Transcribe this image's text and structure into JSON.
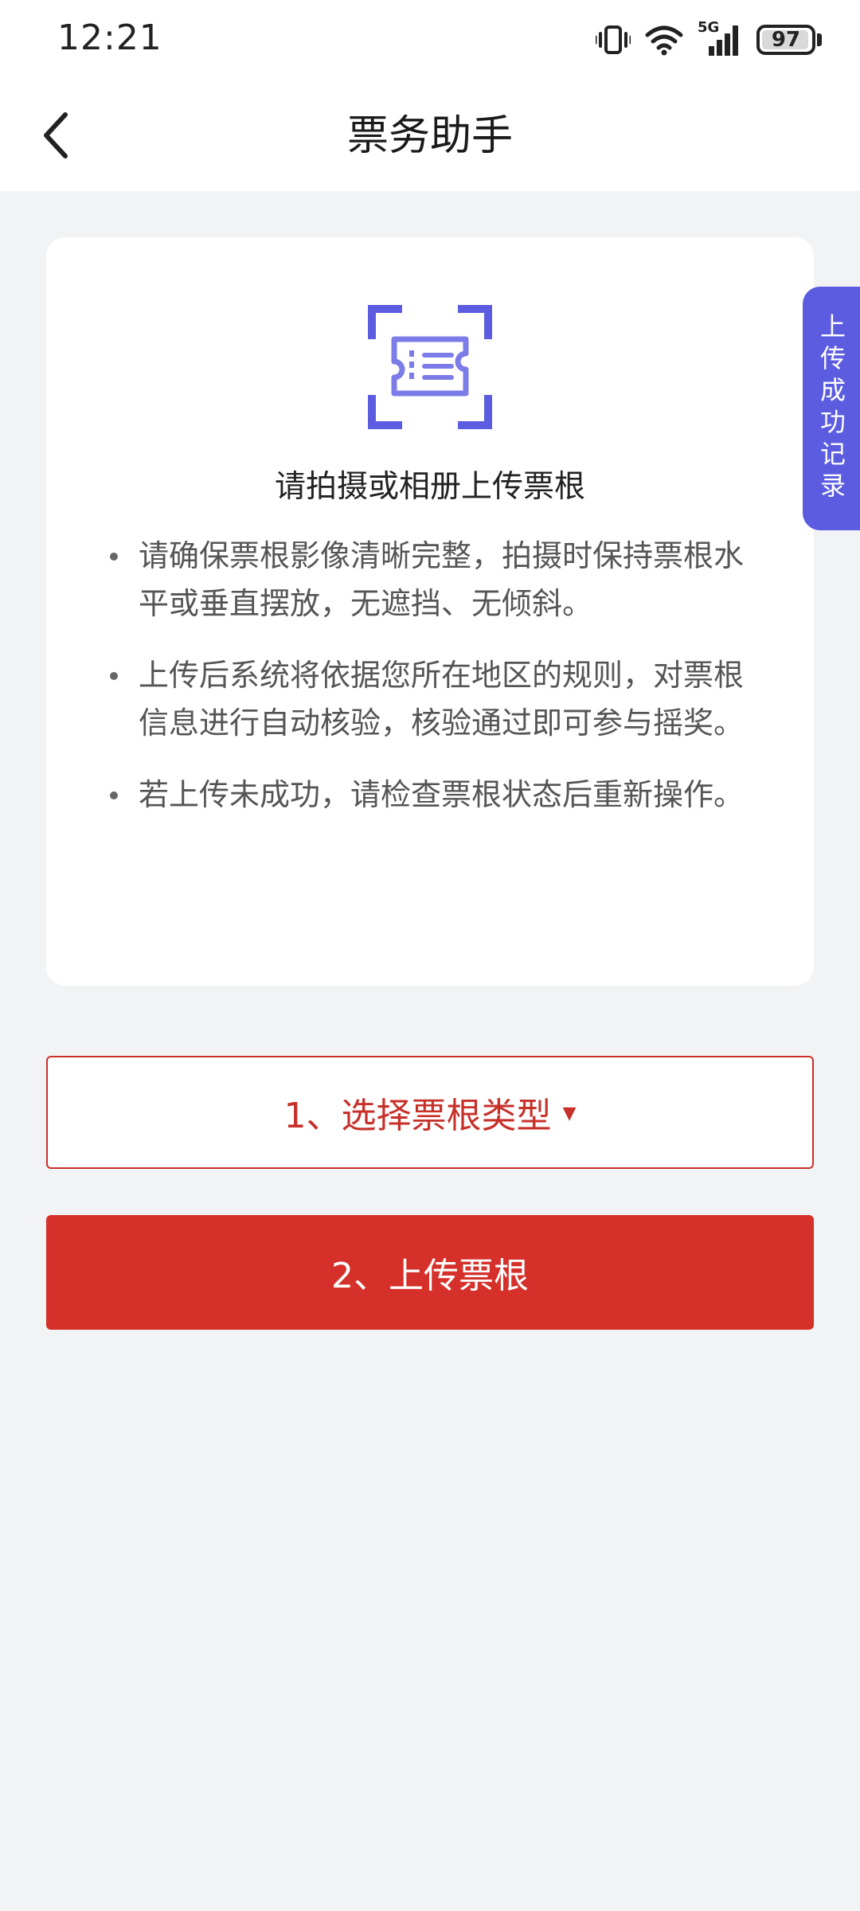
{
  "status_bar": {
    "time": "12:21",
    "network": "5G",
    "battery": "97",
    "battery_level": 0.97,
    "icons": [
      "vibrate-icon",
      "wifi-icon",
      "signal-icon",
      "battery-icon"
    ]
  },
  "header": {
    "title": "票务助手",
    "back_icon": "chevron-left-icon"
  },
  "card": {
    "icon": "ticket-scan-icon",
    "heading": "请拍摄或相册上传票根",
    "tips": [
      "请确保票根影像清晰完整，拍摄时保持票根水平或垂直摆放，无遮挡、无倾斜。",
      "上传后系统将依据您所在地区的规则，对票根信息进行自动核验，核验通过即可参与摇奖。",
      "若上传未成功，请检查票根状态后重新操作。"
    ]
  },
  "buttons": {
    "select_type": "1、选择票根类型",
    "select_caret": "▾",
    "upload": "2、上传票根"
  },
  "side_tab": {
    "label": "上传成功记录"
  },
  "colors": {
    "accent_red": "#d6302a",
    "accent_purple": "#5b5ce0",
    "background": "#f2f3f5"
  }
}
